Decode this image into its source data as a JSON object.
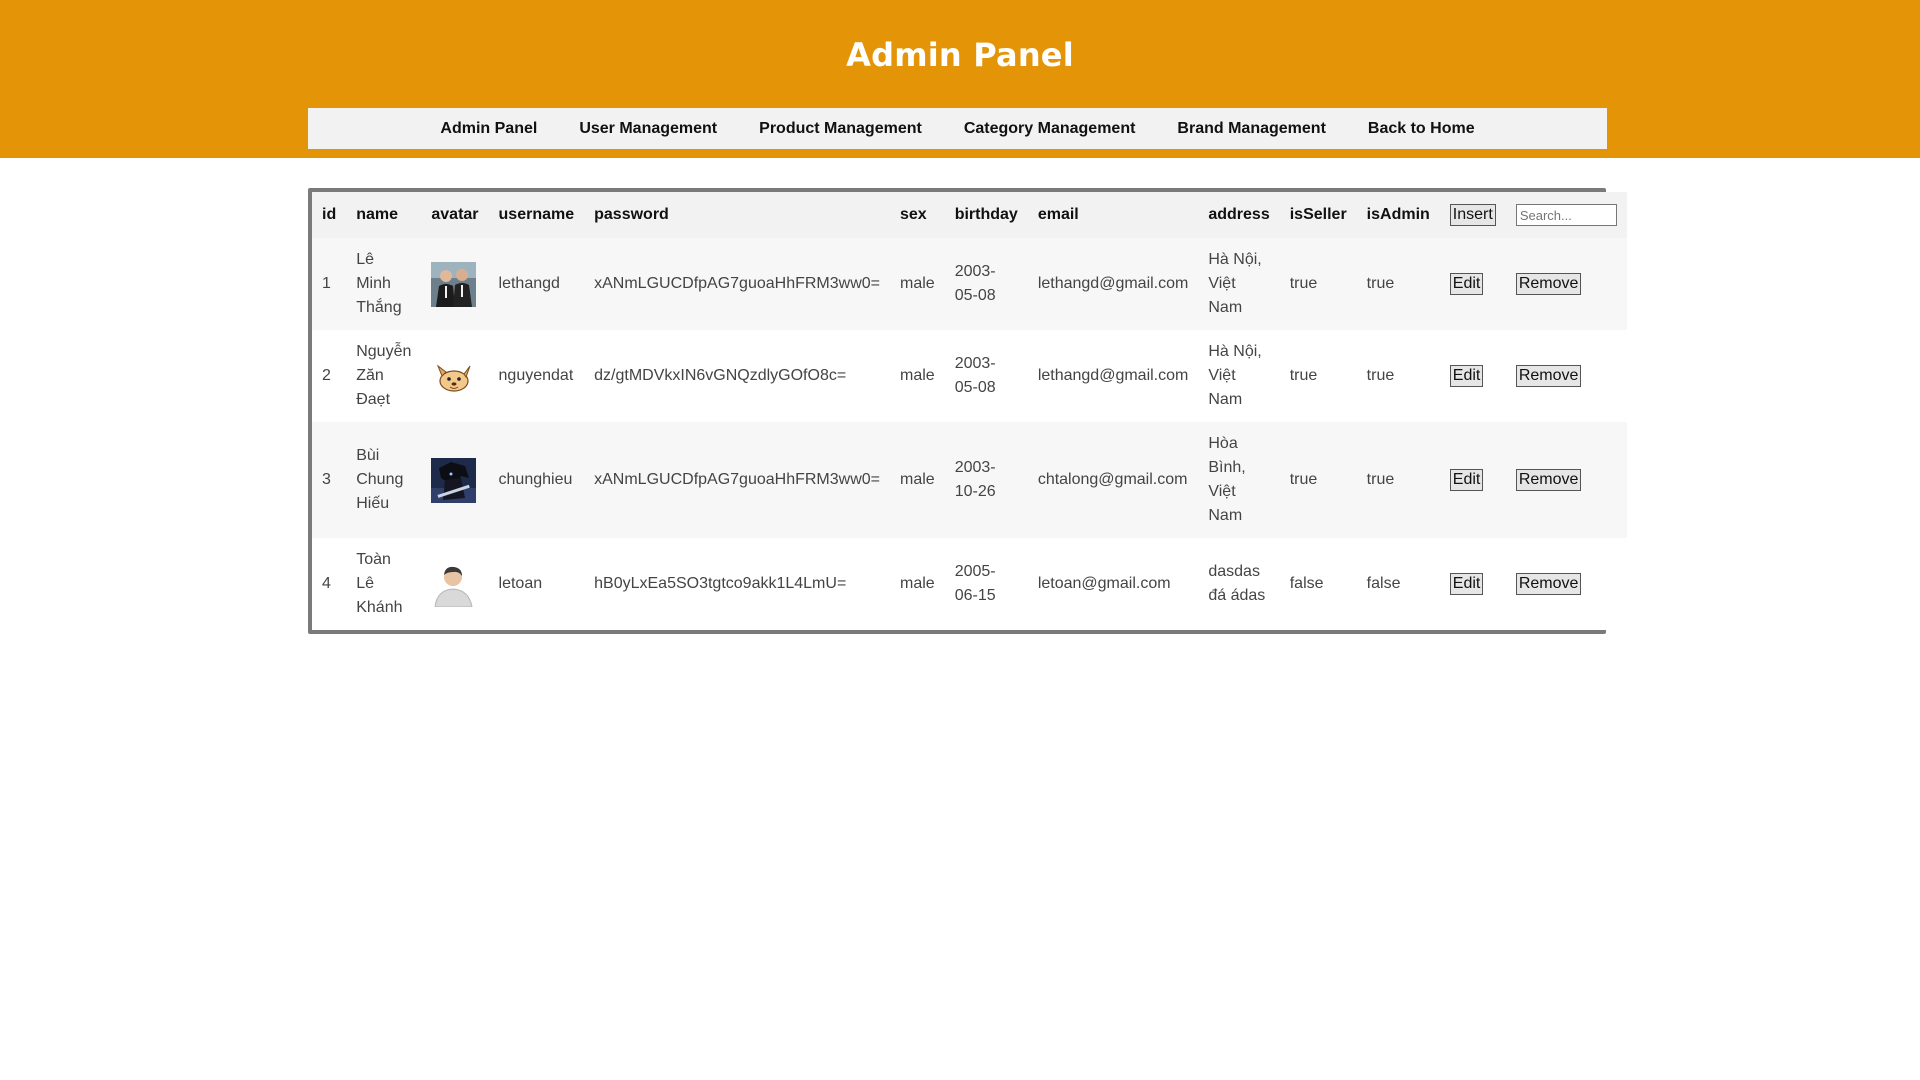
{
  "page": {
    "title": "Admin Panel"
  },
  "nav": {
    "items": [
      {
        "label": "Admin Panel"
      },
      {
        "label": "User Management"
      },
      {
        "label": "Product Management"
      },
      {
        "label": "Category Management"
      },
      {
        "label": "Brand Management"
      },
      {
        "label": "Back to Home"
      }
    ]
  },
  "table": {
    "headers": {
      "id": "id",
      "name": "name",
      "avatar": "avatar",
      "username": "username",
      "password": "password",
      "sex": "sex",
      "birthday": "birthday",
      "email": "email",
      "address": "address",
      "isSeller": "isSeller",
      "isAdmin": "isAdmin"
    },
    "insert_label": "Insert",
    "search_placeholder": "Search...",
    "edit_label": "Edit",
    "remove_label": "Remove",
    "rows": [
      {
        "id": "1",
        "name": "Lê Minh Thắng",
        "avatar": "photo-two-people-icon",
        "username": "lethangd",
        "password": "xANmLGUCDfpAG7guoaHhFRM3ww0=",
        "sex": "male",
        "birthday": "2003-05-08",
        "email": "lethangd@gmail.com",
        "address": "Hà Nội, Việt Nam",
        "isSeller": "true",
        "isAdmin": "true"
      },
      {
        "id": "2",
        "name": "Nguyễn Zăn Đaẹt",
        "avatar": "cartoon-dog-icon",
        "username": "nguyendat",
        "password": "dz/gtMDVkxIN6vGNQzdlyGOfO8c=",
        "sex": "male",
        "birthday": "2003-05-08",
        "email": "lethangd@gmail.com",
        "address": "Hà Nội, Việt Nam",
        "isSeller": "true",
        "isAdmin": "true"
      },
      {
        "id": "3",
        "name": "Bùi Chung Hiếu",
        "avatar": "anime-character-icon",
        "username": "chunghieu",
        "password": "xANmLGUCDfpAG7guoaHhFRM3ww0=",
        "sex": "male",
        "birthday": "2003-10-26",
        "email": "chtalong@gmail.com",
        "address": "Hòa Bình, Việt Nam",
        "isSeller": "true",
        "isAdmin": "true"
      },
      {
        "id": "4",
        "name": "Toàn Lê Khánh",
        "avatar": "default-user-icon",
        "username": "letoan",
        "password": "hB0yLxEa5SO3tgtco9akk1L4LmU=",
        "sex": "male",
        "birthday": "2005-06-15",
        "email": "letoan@gmail.com",
        "address": "dasdas đá ádas",
        "isSeller": "false",
        "isAdmin": "false"
      }
    ]
  },
  "colors": {
    "header_bg": "#e49507",
    "nav_bg": "#f2f2f2",
    "table_border": "#7a7a7a"
  }
}
